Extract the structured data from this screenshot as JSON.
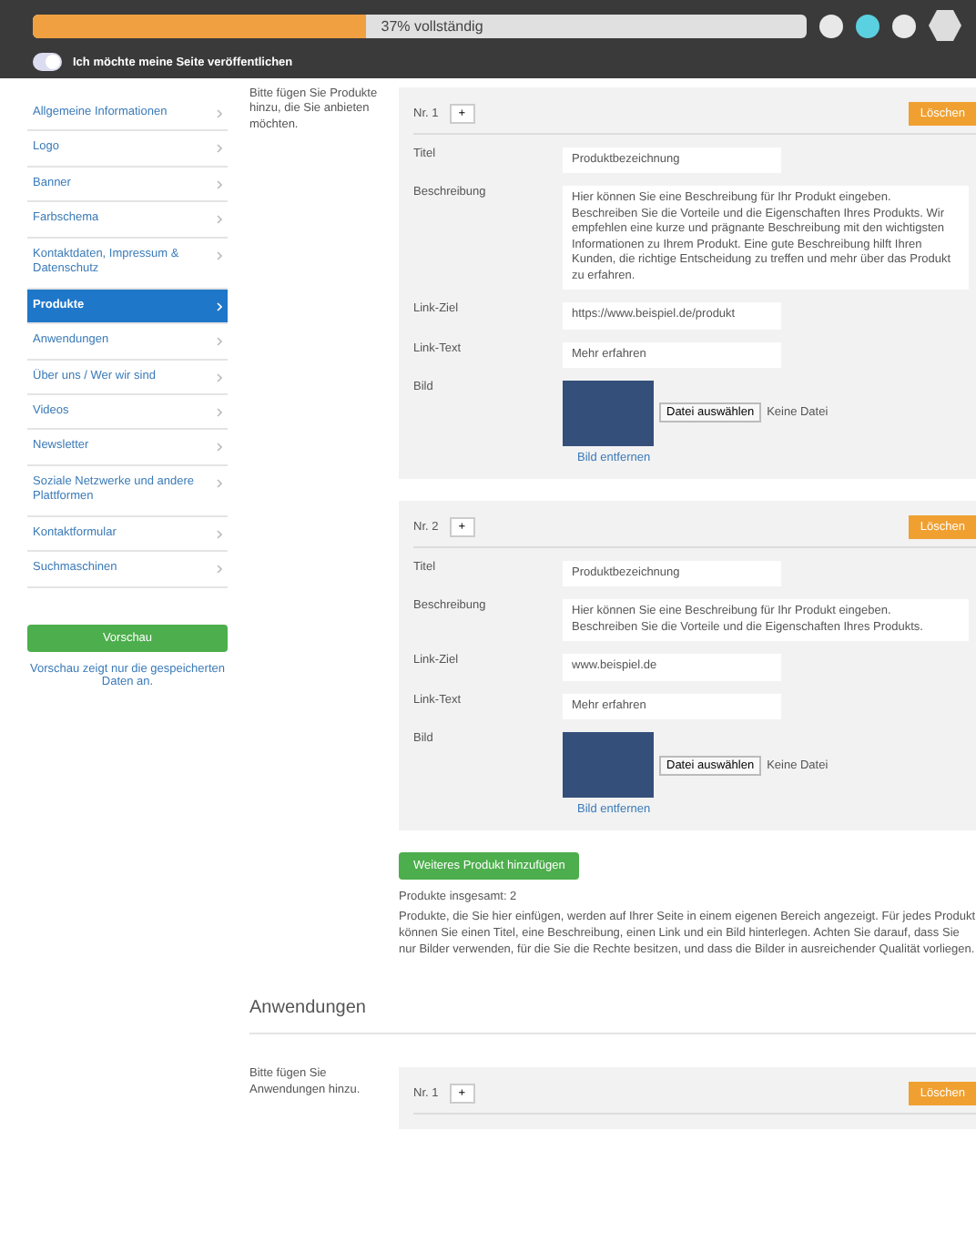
{
  "header": {
    "progress": {
      "level": 0.43,
      "label": "37% vollständig"
    },
    "toggle": {
      "on": true,
      "label": "Ich möchte meine Seite veröffentlichen"
    }
  },
  "sidebar": {
    "items": [
      {
        "label": "Allgemeine Informationen",
        "selected": false
      },
      {
        "label": "Logo",
        "selected": false
      },
      {
        "label": "Banner",
        "selected": false
      },
      {
        "label": "Farbschema",
        "selected": false
      },
      {
        "label": "Kontaktdaten, Impressum & Datenschutz",
        "selected": false
      },
      {
        "label": "Produkte",
        "selected": true
      },
      {
        "label": "Anwendungen",
        "selected": false
      },
      {
        "label": "Über uns / Wer wir sind",
        "selected": false
      },
      {
        "label": "Videos",
        "selected": false
      },
      {
        "label": "Newsletter",
        "selected": false
      },
      {
        "label": "Soziale Netzwerke und andere Plattformen",
        "selected": false
      },
      {
        "label": "Kontaktformular",
        "selected": false
      },
      {
        "label": "Suchmaschinen",
        "selected": false
      }
    ],
    "preview_button": "Vorschau",
    "note": "Vorschau zeigt nur die gespeicherten Daten an."
  },
  "sections": [
    {
      "description": "Bitte fügen Sie Produkte hinzu, die Sie anbieten möchten.",
      "entries": [
        {
          "number": "Nr. 1",
          "add": "+",
          "delete": "Löschen",
          "fields": [
            {
              "kind": "input",
              "label": "Titel",
              "value": "Produktbezeichnung"
            },
            {
              "kind": "textarea",
              "label": "Beschreibung",
              "value": "Hier können Sie eine Beschreibung für Ihr Produkt eingeben. Beschreiben Sie die Vorteile und die Eigenschaften Ihres Produkts. Wir empfehlen eine kurze und prägnante Beschreibung mit den wichtigsten Informationen zu Ihrem Produkt. Eine gute Beschreibung hilft Ihren Kunden, die richtige Entscheidung zu treffen und mehr über das Produkt zu erfahren."
            },
            {
              "kind": "input",
              "label": "Link-Ziel",
              "value": "https://www.beispiel.de/produkt"
            },
            {
              "kind": "input",
              "label": "Link-Text",
              "value": "Mehr erfahren"
            },
            {
              "kind": "image",
              "label": "Bild",
              "button": "Datei auswählen",
              "file": "Keine Datei",
              "remove": "Bild entfernen"
            }
          ]
        },
        {
          "number": "Nr. 2",
          "add": "+",
          "delete": "Löschen",
          "fields": [
            {
              "kind": "input",
              "label": "Titel",
              "value": "Produktbezeichnung"
            },
            {
              "kind": "textarea",
              "label": "Beschreibung",
              "value": "Hier können Sie eine Beschreibung für Ihr Produkt eingeben. Beschreiben Sie die Vorteile und die Eigenschaften Ihres Produkts."
            },
            {
              "kind": "input",
              "label": "Link-Ziel",
              "value": "www.beispiel.de"
            },
            {
              "kind": "input",
              "label": "Link-Text",
              "value": "Mehr erfahren"
            },
            {
              "kind": "image",
              "label": "Bild",
              "button": "Datei auswählen",
              "file": "Keine Datei",
              "remove": "Bild entfernen"
            }
          ]
        }
      ],
      "add_button": "Weiteres Produkt hinzufügen",
      "count": "Produkte insgesamt: 2",
      "hint": "Produkte, die Sie hier einfügen, werden auf Ihrer Seite in einem eigenen Bereich angezeigt. Für jedes Produkt können Sie einen Titel, eine Beschreibung, einen Link und ein Bild hinterlegen. Achten Sie darauf, dass Sie nur Bilder verwenden, für die Sie die Rechte besitzen, und dass die Bilder in ausreichender Qualität vorliegen."
    },
    {
      "description": "Bitte fügen Sie Anwendungen hinzu.",
      "title": "Anwendungen",
      "entries": [
        {
          "number": "Nr. 1",
          "add": "+",
          "delete": "Löschen"
        }
      ]
    }
  ]
}
